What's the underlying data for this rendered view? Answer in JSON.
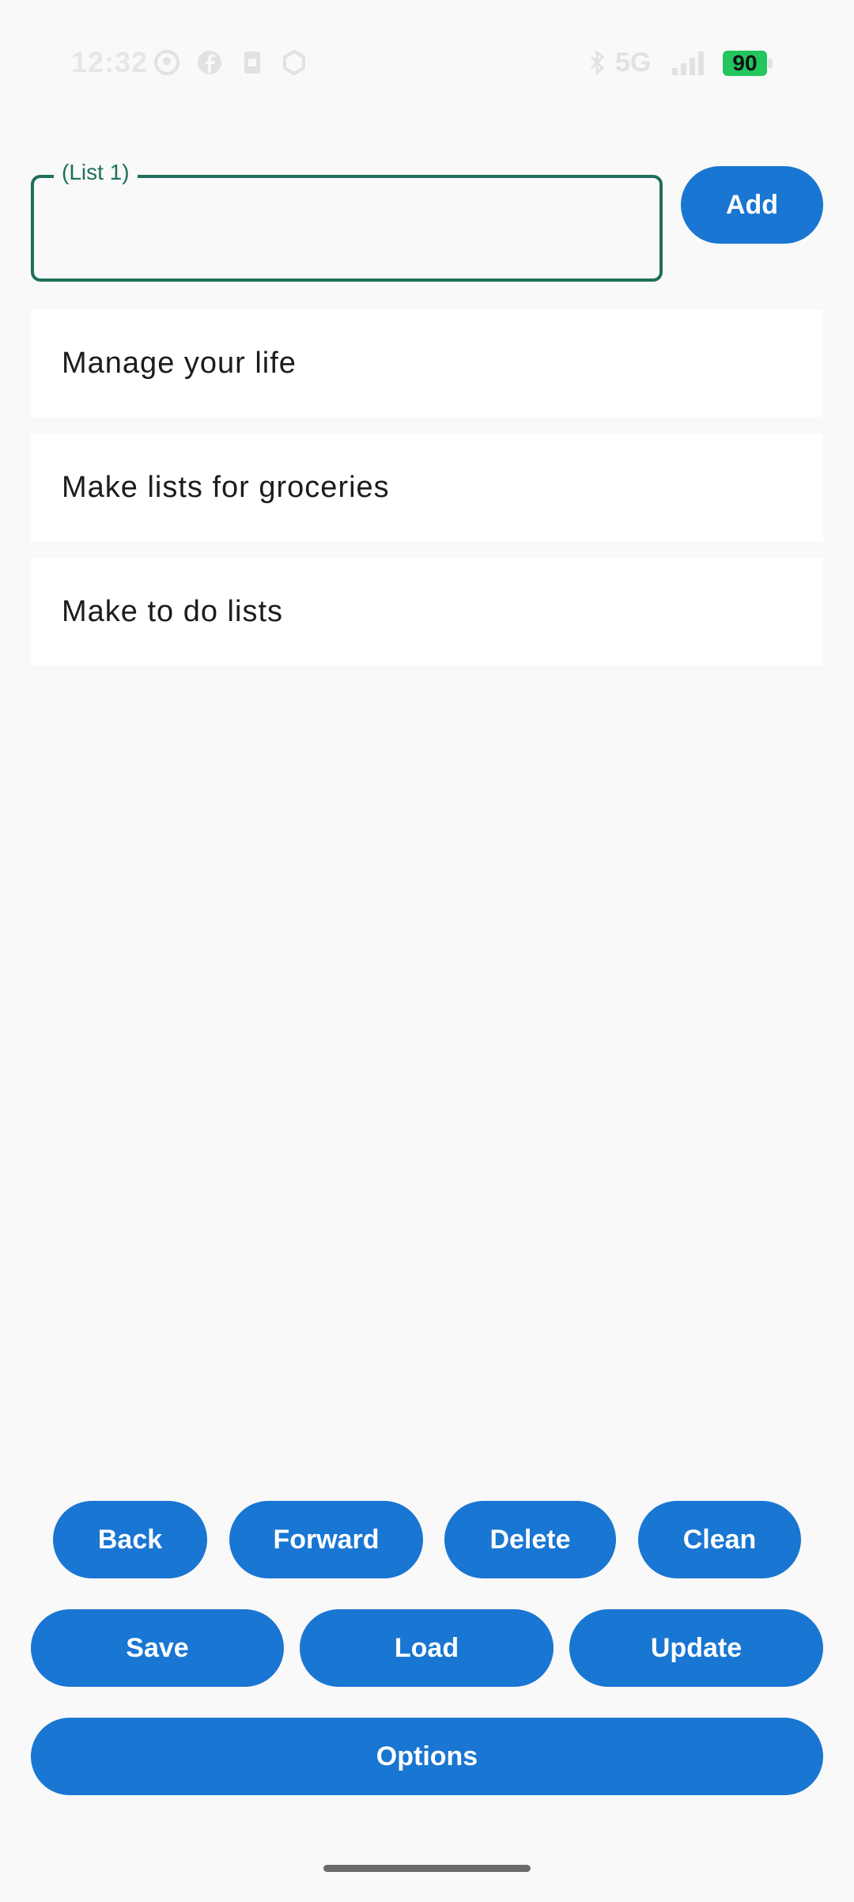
{
  "status_bar": {
    "time": "12:32",
    "network": "5G",
    "battery": "90"
  },
  "input": {
    "label": "(List 1)",
    "value": "",
    "placeholder": ""
  },
  "add_button": "Add",
  "list_items": [
    "Manage your life",
    "Make lists for groceries",
    "Make to do lists"
  ],
  "buttons_row1": [
    "Back",
    "Forward",
    "Delete",
    "Clean"
  ],
  "buttons_row2": [
    "Save",
    "Load",
    "Update"
  ],
  "options_button": "Options",
  "colors": {
    "accent": "#1976d2",
    "field_outline": "#1f6f5c",
    "background": "#f9f9f9"
  }
}
